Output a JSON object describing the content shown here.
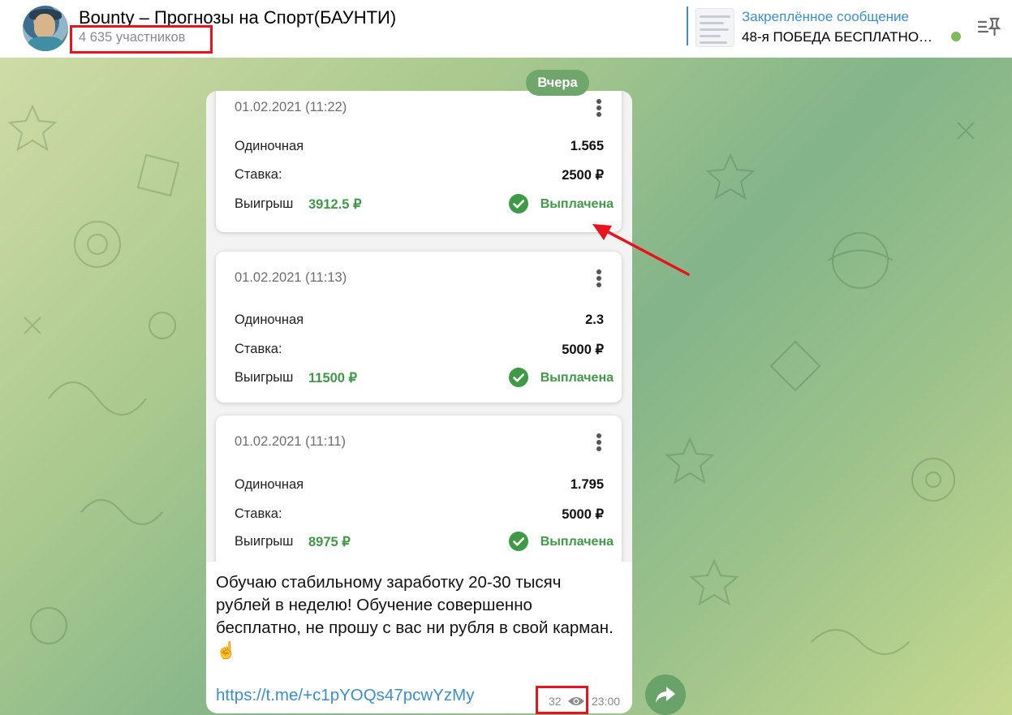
{
  "header": {
    "channel_title": "Bounty – Прогнозы на Спорт(БАУНТИ)",
    "members": "4 635 участников",
    "pinned_label": "Закреплённое сообщение",
    "pinned_text": "48-я ПОБЕДА БЕСПЛАТНО…",
    "pin_icon": "pin-list-icon"
  },
  "date_separator": "Вчера",
  "bets": [
    {
      "date": "01.02.2021 (11:22)",
      "type": "Одиночная",
      "odds": "1.565",
      "stake_label": "Ставка:",
      "stake": "2500 ₽",
      "win_label": "Выигрыш",
      "win": "3912.5 ₽",
      "status": "Выплачена"
    },
    {
      "date": "01.02.2021 (11:13)",
      "type": "Одиночная",
      "odds": "2.3",
      "stake_label": "Ставка:",
      "stake": "5000 ₽",
      "win_label": "Выигрыш",
      "win": "11500 ₽",
      "status": "Выплачена"
    },
    {
      "date": "01.02.2021 (11:11)",
      "type": "Одиночная",
      "odds": "1.795",
      "stake_label": "Ставка:",
      "stake": "5000 ₽",
      "win_label": "Выигрыш",
      "win": "8975 ₽",
      "status": "Выплачена"
    }
  ],
  "message": {
    "text": "Обучаю стабильному заработку 20-30 тысяч рублей в неделю! Обучение совершенно бесплатно, не прошу с вас ни рубля в свой карман. ☝️",
    "link": "https://t.me/+c1pYOQs47pcwYzMy",
    "views": "32",
    "time": "23:00"
  },
  "colors": {
    "accent_blue": "#3a8fd4",
    "paid_green": "#3f9a45",
    "highlight_red": "#e8131b"
  }
}
